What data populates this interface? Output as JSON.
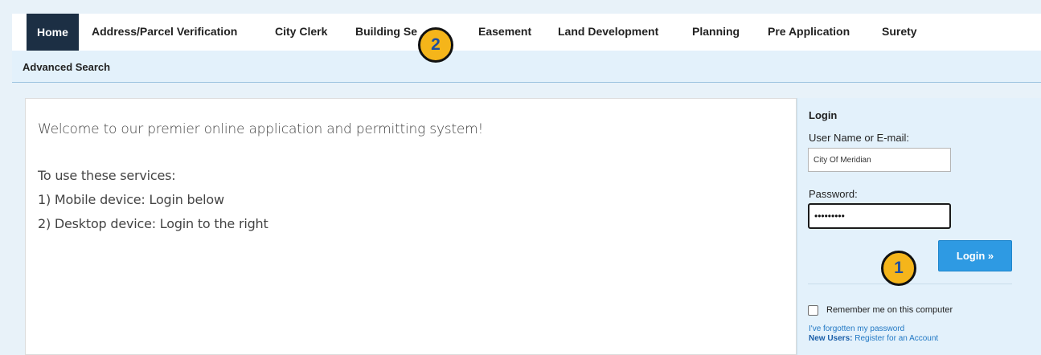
{
  "nav": {
    "tabs": [
      {
        "label": "Home"
      },
      {
        "label": "Address/Parcel Verification"
      },
      {
        "label": "City Clerk"
      },
      {
        "label": "Building Se"
      },
      {
        "label": "Easement"
      },
      {
        "label": "Land Development"
      },
      {
        "label": "Planning"
      },
      {
        "label": "Pre Application"
      },
      {
        "label": "Surety"
      }
    ],
    "sub": {
      "advanced_search": "Advanced Search"
    }
  },
  "main": {
    "welcome": "Welcome to our premier online application and permitting system!",
    "lines": [
      "To use these services:",
      "1) Mobile device: Login below",
      "2) Desktop device: Login to the right"
    ]
  },
  "login": {
    "title": "Login",
    "username_label": "User Name or E-mail:",
    "username_value": "City Of Meridian",
    "password_label": "Password:",
    "password_value": "•••••••••",
    "button": "Login »",
    "remember": "Remember me on this computer",
    "forgot": "I've forgotten my password",
    "new_users_bold": "New Users:",
    "new_users_link": "Register for an Account"
  },
  "callouts": {
    "one": "1",
    "two": "2"
  }
}
